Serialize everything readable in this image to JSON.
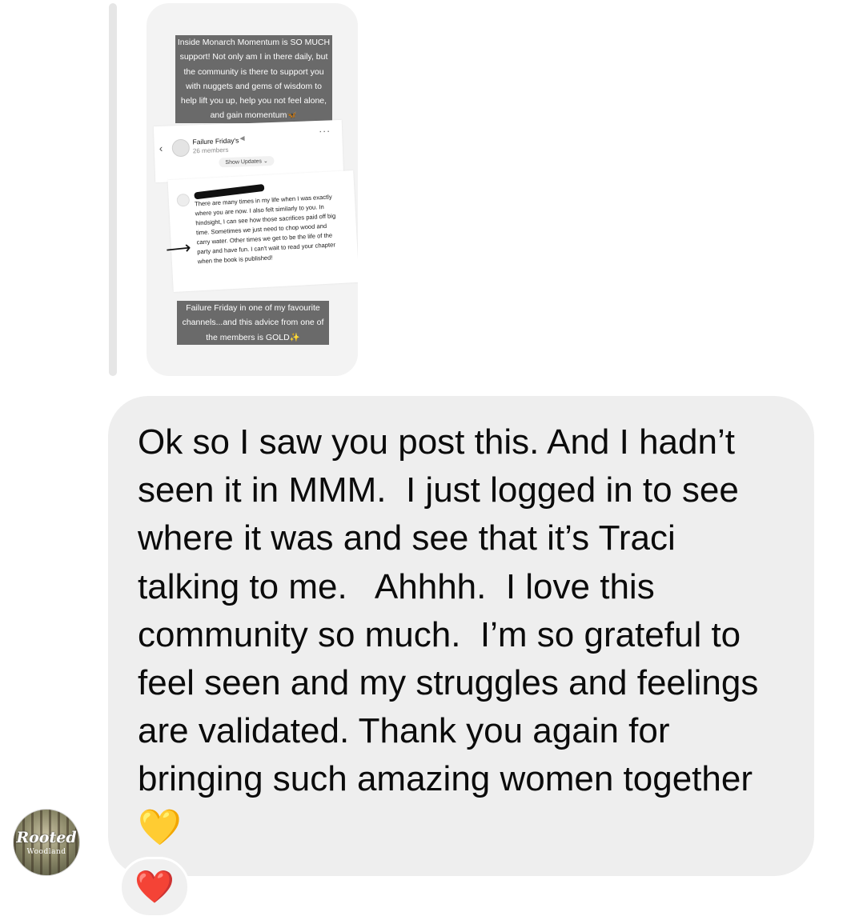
{
  "story": {
    "caption_top": "Inside Monarch Momentum is SO MUCH support! Not only am I in there daily, but the community is there to support you with nuggets and gems of wisdom to help lift you up, help you not feel alone, and gain momentum🦋",
    "group_name": "Failure Friday's",
    "group_members": "26 members",
    "show_updates": "Show Updates ⌄",
    "comment_text": "There are many times in my life when I was exactly where you are now. I also felt similarly to you. In hindsight, I can see how those sacrifices paid off big time. Sometimes we just need to chop wood and carry water. Other times we get to be the life of the party and have fun. I can't wait to read your chapter when the book is published!",
    "caption_bottom": "Failure Friday in one of my favourite channels...and this advice from one of the members is GOLD✨"
  },
  "message": {
    "text": "Ok so I saw you post this. And I hadn’t seen it in MMM.  I just logged in to see where it was and see that it’s Traci talking to me.   Ahhhh.  I love this community so much.  I’m so grateful to feel seen and my struggles and feelings are validated. Thank you again for bringing such amazing women together 💛"
  },
  "sender_avatar": {
    "title": "Rooted",
    "subtitle": "Woodland"
  },
  "reaction": {
    "emoji": "❤️"
  },
  "icons": {
    "back": "chevron-left-icon",
    "speaker": "speaker-icon",
    "more": "more-dots-icon",
    "arrow": "arrow-right-icon"
  }
}
